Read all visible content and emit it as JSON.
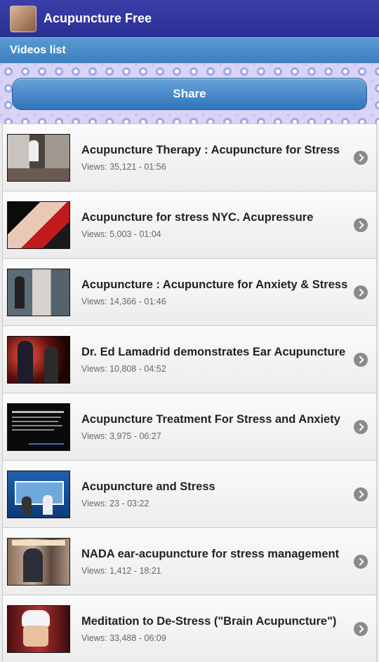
{
  "app": {
    "title": "Acupuncture Free"
  },
  "subheader": {
    "title": "Videos list"
  },
  "share": {
    "label": "Share"
  },
  "videos": [
    {
      "title": "Acupuncture Therapy : Acupuncture for Stress",
      "meta": "Views: 35,121 - 01:56"
    },
    {
      "title": "Acupuncture for stress NYC. Acupressure",
      "meta": "Views: 5,003 - 01:04"
    },
    {
      "title": "Acupuncture : Acupuncture for Anxiety & Stress",
      "meta": "Views: 14,366 - 01:46"
    },
    {
      "title": "Dr. Ed Lamadrid demonstrates Ear Acupuncture",
      "meta": "Views: 10,808 - 04:52"
    },
    {
      "title": "Acupuncture Treatment For Stress and Anxiety",
      "meta": "Views: 3,975 - 06:27"
    },
    {
      "title": "Acupuncture and Stress",
      "meta": "Views: 23 - 03:22"
    },
    {
      "title": "NADA ear-acupuncture for stress management",
      "meta": "Views: 1,412 - 18:21"
    },
    {
      "title": "Meditation to De-Stress (\"Brain Acupuncture\")",
      "meta": "Views: 33,488 - 06:09"
    }
  ]
}
